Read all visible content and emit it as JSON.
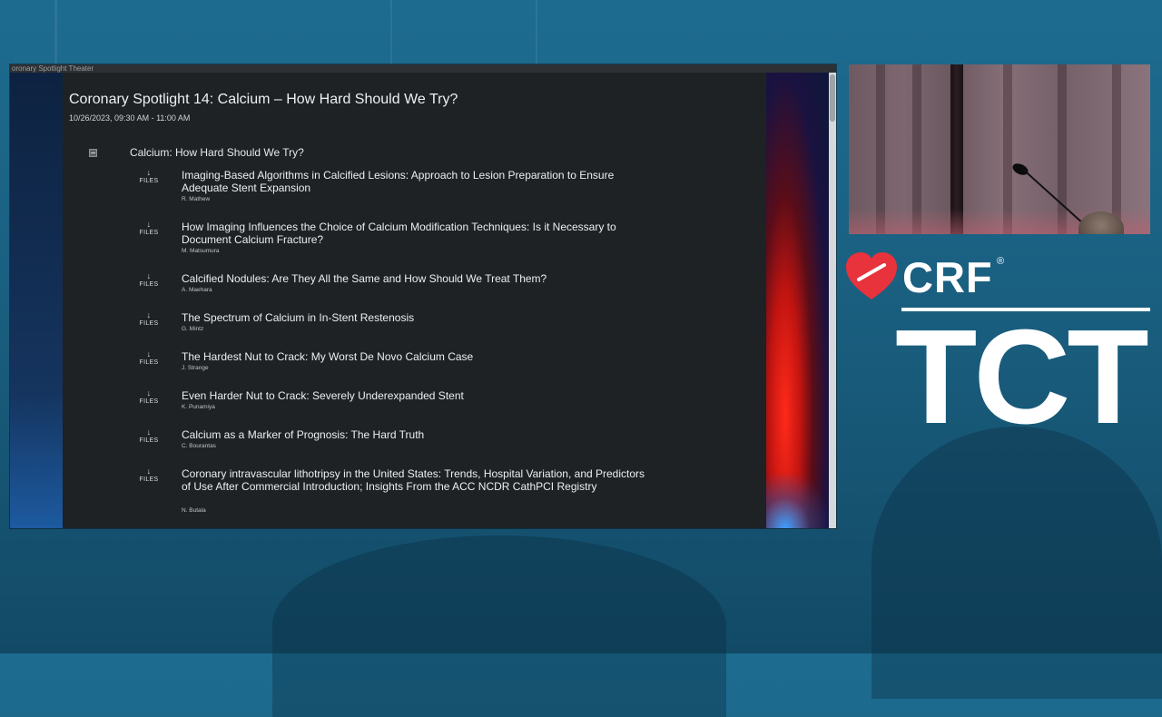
{
  "window": {
    "title": "oronary Spotlight Theater"
  },
  "session": {
    "title": "Coronary Spotlight 14: Calcium – How Hard Should We Try?",
    "datetime": "10/26/2023, 09:30 AM - 11:00 AM"
  },
  "section": {
    "label": "Calcium: How Hard Should We Try?",
    "collapse_icon": "collapse-square-icon"
  },
  "files_label": "FILES",
  "files_icon": "down-arrow-icon",
  "talks": [
    {
      "title": "Imaging-Based Algorithms in Calcified Lesions: Approach to Lesion Preparation to Ensure Adequate Stent Expansion",
      "speaker": "R. Mathew"
    },
    {
      "title": "How Imaging Influences the Choice of Calcium Modification Techniques: Is it Necessary to Document Calcium Fracture?",
      "speaker": "M. Matsumura"
    },
    {
      "title": "Calcified Nodules: Are They All the Same and How Should We Treat Them?",
      "speaker": "A. Maehara"
    },
    {
      "title": "The Spectrum of Calcium in In-Stent Restenosis",
      "speaker": "G. Mintz"
    },
    {
      "title": "The Hardest Nut to Crack: My Worst De Novo Calcium Case",
      "speaker": "J. Strange"
    },
    {
      "title": "Even Harder Nut to Crack: Severely Underexpanded Stent",
      "speaker": "K. Punamiya"
    },
    {
      "title": "Calcium as a Marker of Prognosis: The Hard Truth",
      "speaker": "C. Bourantas"
    },
    {
      "title": "Coronary intravascular lithotripsy in the United States: Trends, Hospital Variation, and Predictors of Use After Commercial Introduction; Insights From the ACC NCDR CathPCI Registry",
      "speaker": "N. Butala"
    }
  ],
  "logos": {
    "crf": "CRF",
    "registered": "®",
    "tct": "TCT"
  },
  "colors": {
    "brand_red": "#e8323c",
    "background_blue": "#1d6c90",
    "panel_dark": "#1e2225"
  }
}
